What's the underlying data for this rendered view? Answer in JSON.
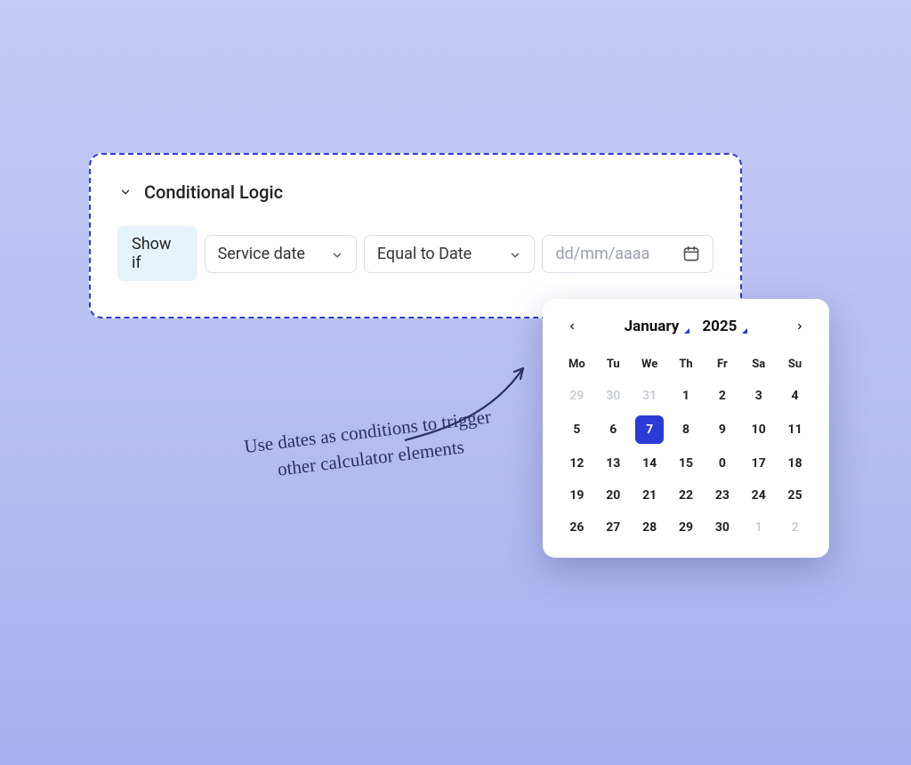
{
  "section": {
    "title": "Conditional Logic"
  },
  "condition": {
    "chip_label": "Show if",
    "field_select": "Service date",
    "operator_select": "Equal to Date",
    "date_placeholder": "dd/mm/aaaa"
  },
  "calendar": {
    "month": "January",
    "year": "2025",
    "dow": [
      "Mo",
      "Tu",
      "We",
      "Th",
      "Fr",
      "Sa",
      "Su"
    ],
    "weeks": [
      [
        {
          "d": "29",
          "muted": true
        },
        {
          "d": "30",
          "muted": true
        },
        {
          "d": "31",
          "muted": true
        },
        {
          "d": "1"
        },
        {
          "d": "2"
        },
        {
          "d": "3"
        },
        {
          "d": "4"
        }
      ],
      [
        {
          "d": "5"
        },
        {
          "d": "6"
        },
        {
          "d": "7",
          "selected": true
        },
        {
          "d": "8"
        },
        {
          "d": "9"
        },
        {
          "d": "10"
        },
        {
          "d": "11"
        }
      ],
      [
        {
          "d": "12"
        },
        {
          "d": "13"
        },
        {
          "d": "14"
        },
        {
          "d": "15"
        },
        {
          "d": "0"
        },
        {
          "d": "17"
        },
        {
          "d": "18"
        }
      ],
      [
        {
          "d": "19"
        },
        {
          "d": "20"
        },
        {
          "d": "21"
        },
        {
          "d": "22"
        },
        {
          "d": "23"
        },
        {
          "d": "24"
        },
        {
          "d": "25"
        }
      ],
      [
        {
          "d": "26"
        },
        {
          "d": "27"
        },
        {
          "d": "28"
        },
        {
          "d": "29"
        },
        {
          "d": "30"
        },
        {
          "d": "1",
          "muted": true
        },
        {
          "d": "2",
          "muted": true
        }
      ]
    ]
  },
  "annotation": {
    "text": "Use dates as conditions to trigger other calculator elements"
  }
}
